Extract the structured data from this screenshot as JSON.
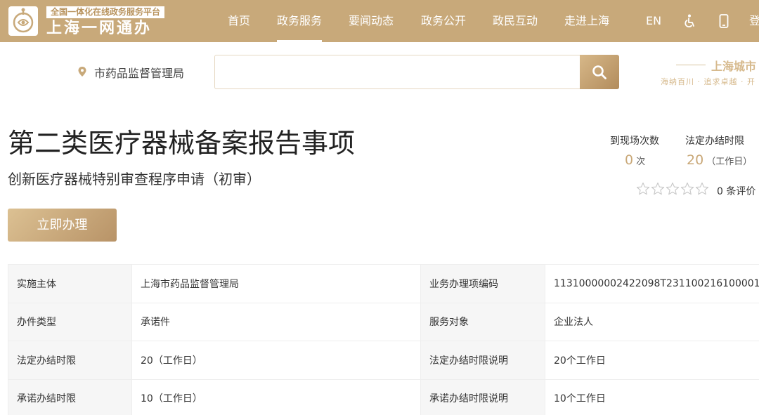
{
  "header": {
    "platform_tagline": "全国一体化在线政务服务平台",
    "platform_name": "上海一网通办",
    "nav": [
      {
        "label": "首页",
        "active": false
      },
      {
        "label": "政务服务",
        "active": true
      },
      {
        "label": "要闻动态",
        "active": false
      },
      {
        "label": "政务公开",
        "active": false
      },
      {
        "label": "政民互动",
        "active": false
      },
      {
        "label": "走进上海",
        "active": false
      }
    ],
    "lang_label": "EN",
    "accessibility_icon": "accessibility-icon",
    "mobile_icon": "mobile-icon",
    "login_label": "登"
  },
  "search": {
    "location": "市药品监督管理局",
    "location_icon": "location-pin-icon",
    "value": "",
    "button_icon": "search-icon",
    "slogan_title": "上海城市",
    "slogan_sub": "海纳百川 · 追求卓越 · 开"
  },
  "item": {
    "title": "第二类医疗器械备案报告事项",
    "subtitle": "创新医疗器械特别审查程序申请（初审）",
    "apply_label": "立即办理",
    "visits_label": "到现场次数",
    "visits_value": "0",
    "visits_unit": "次",
    "limit_label": "法定办结时限",
    "limit_value": "20",
    "limit_unit": "（工作日）",
    "rating": 0,
    "rating_max": 5,
    "rating_text": "0 条评价"
  },
  "info_rows": [
    {
      "l1": "实施主体",
      "v1": "上海市药品监督管理局",
      "l2": "业务办理项编码",
      "v2": "11310000002422098T231100216100001"
    },
    {
      "l1": "办件类型",
      "v1": "承诺件",
      "l2": "服务对象",
      "v2": "企业法人"
    },
    {
      "l1": "法定办结时限",
      "v1": "20（工作日）",
      "l2": "法定办结时限说明",
      "v2": "20个工作日"
    },
    {
      "l1": "承诺办结时限",
      "v1": "10（工作日）",
      "l2": "承诺办结时限说明",
      "v2": "10个工作日"
    }
  ],
  "colors": {
    "brand": "#c8a97a",
    "accent_text": "#c9a878",
    "button_gradient_start": "#dcc193",
    "button_gradient_end": "#b89367"
  }
}
